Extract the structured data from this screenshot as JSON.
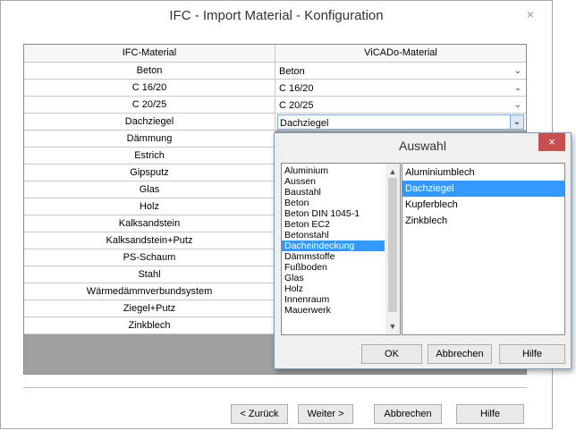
{
  "window": {
    "title": "IFC - Import Material - Konfiguration",
    "close_glyph": "×"
  },
  "grid": {
    "col_left": "IFC-Material",
    "col_right": "ViCADo-Material",
    "rows": [
      {
        "ifc": "Beton",
        "vicado": "Beton"
      },
      {
        "ifc": "C 16/20",
        "vicado": "C 16/20"
      },
      {
        "ifc": "C 20/25",
        "vicado": "C 20/25"
      },
      {
        "ifc": "Dachziegel",
        "vicado": "Dachziegel"
      },
      {
        "ifc": "Dämmung",
        "vicado": ""
      },
      {
        "ifc": "Estrich",
        "vicado": ""
      },
      {
        "ifc": "Gipsputz",
        "vicado": ""
      },
      {
        "ifc": "Glas",
        "vicado": ""
      },
      {
        "ifc": "Holz",
        "vicado": ""
      },
      {
        "ifc": "Kalksandstein",
        "vicado": ""
      },
      {
        "ifc": "Kalksandstein+Putz",
        "vicado": ""
      },
      {
        "ifc": "PS-Schaum",
        "vicado": ""
      },
      {
        "ifc": "Stahl",
        "vicado": ""
      },
      {
        "ifc": "Wärmedämmverbundsystem",
        "vicado": ""
      },
      {
        "ifc": "Ziegel+Putz",
        "vicado": ""
      },
      {
        "ifc": "Zinkblech",
        "vicado": ""
      }
    ]
  },
  "footer": {
    "back": "< Zurück",
    "next": "Weiter >",
    "cancel": "Abbrechen",
    "help": "Hilfe"
  },
  "popup": {
    "title": "Auswahl",
    "close_glyph": "×",
    "categories": [
      "Aluminium",
      "Aussen",
      "Baustahl",
      "Beton",
      "Beton DIN 1045-1",
      "Beton EC2",
      "Betonstahl",
      "Dacheindeckung",
      "Dämmstoffe",
      "Fußboden",
      "Glas",
      "Holz",
      "Innenraum",
      "Mauerwerk"
    ],
    "selected_category": "Dacheindeckung",
    "materials": [
      "Aluminiumblech",
      "Dachziegel",
      "Kupferblech",
      "Zinkblech"
    ],
    "selected_material": "Dachziegel",
    "ok": "OK",
    "cancel": "Abbrechen",
    "help": "Hilfe"
  },
  "colors": {
    "selection": "#3399ff",
    "close_red": "#c75050",
    "grid_bg": "#a0a0a0"
  }
}
